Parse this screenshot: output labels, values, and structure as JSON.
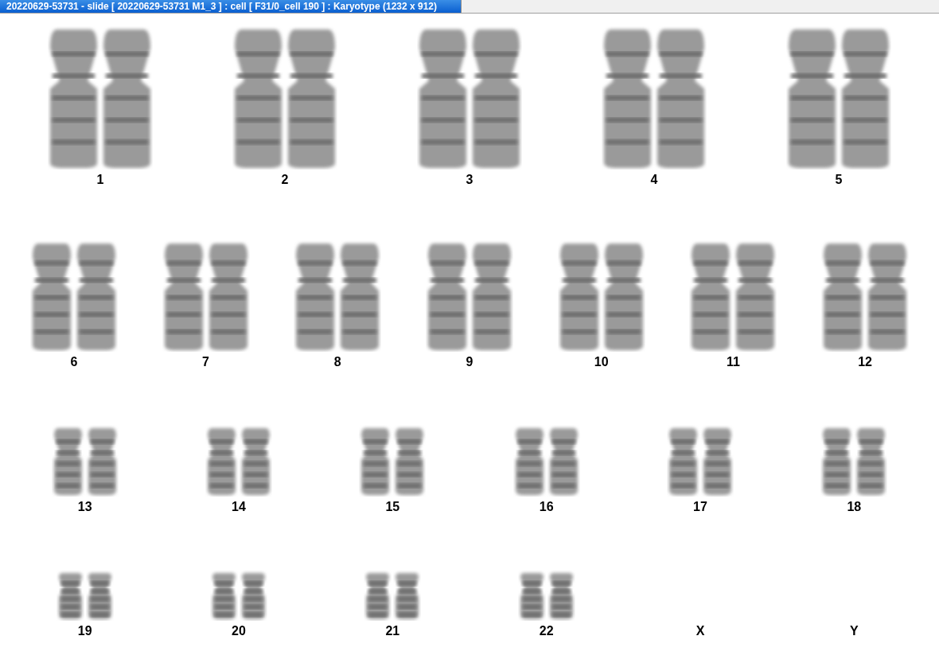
{
  "window": {
    "title": "20220629-53731 - slide [ 20220629-53731 M1_3 ] : cell [ F31/0_cell 190 ] : Karyotype  (1232 x 912)"
  },
  "karyotype": {
    "rows": [
      [
        {
          "label": "1",
          "kind": "pair"
        },
        {
          "label": "2",
          "kind": "pair"
        },
        {
          "label": "3",
          "kind": "pair"
        },
        {
          "label": "4",
          "kind": "pair"
        },
        {
          "label": "5",
          "kind": "pair"
        }
      ],
      [
        {
          "label": "6",
          "kind": "pair"
        },
        {
          "label": "7",
          "kind": "pair"
        },
        {
          "label": "8",
          "kind": "pair"
        },
        {
          "label": "9",
          "kind": "pair"
        },
        {
          "label": "10",
          "kind": "pair"
        },
        {
          "label": "11",
          "kind": "pair"
        },
        {
          "label": "12",
          "kind": "pair"
        }
      ],
      [
        {
          "label": "13",
          "kind": "pair"
        },
        {
          "label": "14",
          "kind": "pair"
        },
        {
          "label": "15",
          "kind": "pair"
        },
        {
          "label": "16",
          "kind": "pair"
        },
        {
          "label": "17",
          "kind": "pair"
        },
        {
          "label": "18",
          "kind": "pair"
        }
      ],
      [
        {
          "label": "19",
          "kind": "pair"
        },
        {
          "label": "20",
          "kind": "pair"
        },
        {
          "label": "21",
          "kind": "pair"
        },
        {
          "label": "22",
          "kind": "pair"
        },
        {
          "label": "X",
          "kind": "empty"
        },
        {
          "label": "Y",
          "kind": "empty"
        }
      ]
    ]
  }
}
